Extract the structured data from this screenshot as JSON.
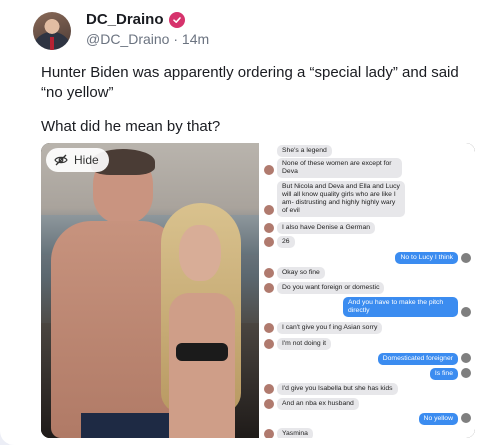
{
  "author": {
    "display_name": "DC_Draino",
    "handle": "@DC_Draino",
    "time": "14m",
    "verified_color": "#d6336c",
    "avatar_icon": "profile-photo"
  },
  "post": {
    "paragraphs": [
      "Hunter Biden was apparently ordering a “special lady” and said “no yellow”",
      "What did he mean by that?"
    ]
  },
  "media": {
    "hide_label": "Hide",
    "hide_icon": "eye-slash-icon",
    "chat": [
      {
        "dir": "recv",
        "text": "She's a legend"
      },
      {
        "dir": "recv",
        "text": "None of these women are except for Deva"
      },
      {
        "dir": "recv",
        "text": "But Nicola and Deva and Ella and Lucy will all know quality girls who are like I am- distrusting and highly highly wary of evil"
      },
      {
        "dir": "recv",
        "text": "I also have Denise a German"
      },
      {
        "dir": "recv",
        "text": "26"
      },
      {
        "dir": "sent",
        "text": "No to Lucy I think"
      },
      {
        "dir": "recv",
        "text": "Okay so fine"
      },
      {
        "dir": "recv",
        "text": "Do you want foreign or domestic"
      },
      {
        "dir": "sent",
        "text": "And you have to make the pitch directly"
      },
      {
        "dir": "recv",
        "text": "I can't give you f ing Asian sorry"
      },
      {
        "dir": "recv",
        "text": "I'm not doing it"
      },
      {
        "dir": "sent",
        "text": "Domesticated foreigner"
      },
      {
        "dir": "sent",
        "text": "Is fine"
      },
      {
        "dir": "recv",
        "text": "I'd give you Isabella but she has kids"
      },
      {
        "dir": "recv",
        "text": "And an nba ex husband"
      },
      {
        "dir": "sent",
        "text": "No yellow"
      },
      {
        "dir": "recv",
        "text": "Yasmina"
      }
    ]
  }
}
